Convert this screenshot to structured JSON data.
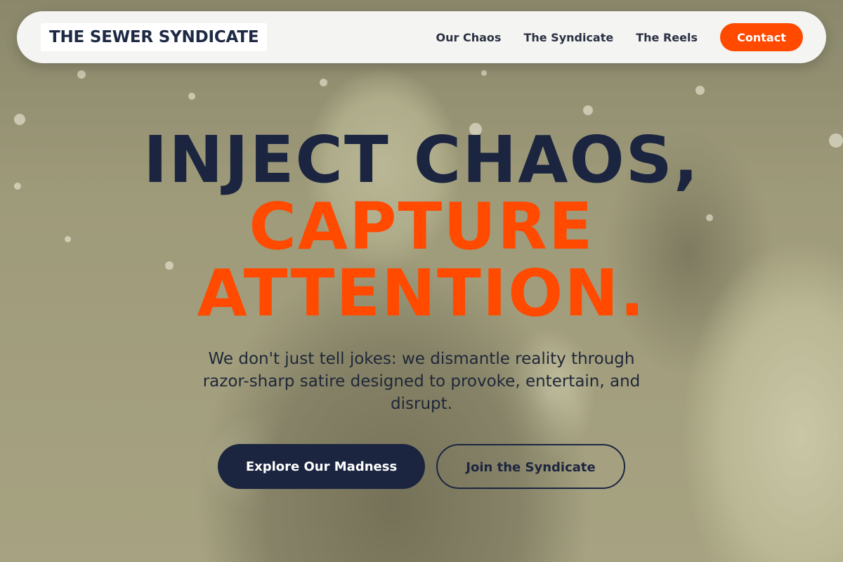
{
  "nav": {
    "logo": "THE SEWER SYNDICATE",
    "links": [
      "Our Chaos",
      "The Syndicate",
      "The Reels"
    ],
    "contact_label": "Contact"
  },
  "hero": {
    "headline_line1": "INJECT CHAOS,",
    "headline_line2": "CAPTURE",
    "headline_line3": "ATTENTION.",
    "subtitle": "We don't just tell jokes: we dismantle reality through razor-sharp satire designed to provoke, entertain, and disrupt.",
    "primary_button": "Explore Our Madness",
    "secondary_button": "Join the Syndicate"
  },
  "colors": {
    "accent": "#ff4a00",
    "navy": "#1c2540",
    "nav_bg": "#f4f4f2"
  }
}
